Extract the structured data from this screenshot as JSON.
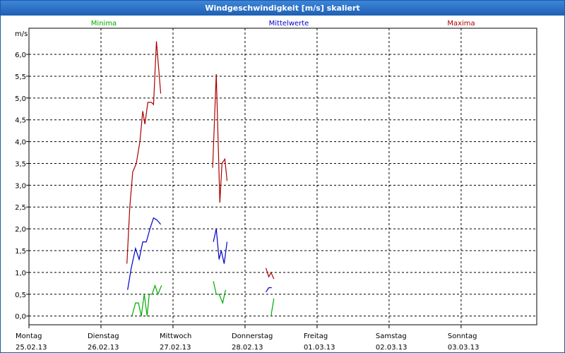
{
  "window": {
    "title": "Windgeschwindigkeit [m/s] skaliert"
  },
  "chart_data": {
    "type": "line",
    "title": "Windgeschwindigkeit [m/s] skaliert",
    "ylabel": "m/s",
    "xlabel": "",
    "ylim": [
      -0.2,
      6.6
    ],
    "xlim": [
      0,
      7.05
    ],
    "grid": true,
    "legend_position": "top",
    "yticks": [
      "0,0",
      "0,5",
      "1,0",
      "1,5",
      "2,0",
      "2,5",
      "3,0",
      "3,5",
      "4,0",
      "4,5",
      "5,0",
      "5,5",
      "6,0"
    ],
    "ytick_values": [
      0,
      0.5,
      1,
      1.5,
      2,
      2.5,
      3,
      3.5,
      4,
      4.5,
      5,
      5.5,
      6
    ],
    "xticks": [
      {
        "day": "Montag",
        "date": "25.02.13",
        "x": 0
      },
      {
        "day": "Dienstag",
        "date": "26.02.13",
        "x": 1
      },
      {
        "day": "Mittwoch",
        "date": "27.02.13",
        "x": 2
      },
      {
        "day": "Donnerstag",
        "date": "28.02.13",
        "x": 3
      },
      {
        "day": "Freitag",
        "date": "01.03.13",
        "x": 4
      },
      {
        "day": "Samstag",
        "date": "02.03.13",
        "x": 5
      },
      {
        "day": "Sonntag",
        "date": "03.03.13",
        "x": 6
      }
    ],
    "series": [
      {
        "name": "Minima",
        "color": "#00aa00",
        "segments": [
          [
            [
              1.43,
              0.0
            ],
            [
              1.48,
              0.3
            ],
            [
              1.52,
              0.3
            ],
            [
              1.56,
              0.0
            ],
            [
              1.6,
              0.5
            ],
            [
              1.64,
              0.0
            ],
            [
              1.67,
              0.5
            ],
            [
              1.71,
              0.5
            ],
            [
              1.75,
              0.7
            ],
            [
              1.79,
              0.5
            ],
            [
              1.84,
              0.7
            ]
          ],
          [
            [
              2.56,
              0.8
            ],
            [
              2.6,
              0.5
            ],
            [
              2.64,
              0.5
            ],
            [
              2.69,
              0.3
            ],
            [
              2.73,
              0.6
            ]
          ],
          [
            [
              3.36,
              0.0
            ],
            [
              3.4,
              0.4
            ]
          ]
        ]
      },
      {
        "name": "Mittelwerte",
        "color": "#0000cc",
        "segments": [
          [
            [
              1.37,
              0.6
            ],
            [
              1.42,
              1.1
            ],
            [
              1.48,
              1.55
            ],
            [
              1.53,
              1.3
            ],
            [
              1.58,
              1.7
            ],
            [
              1.63,
              1.7
            ],
            [
              1.68,
              2.0
            ],
            [
              1.73,
              2.25
            ],
            [
              1.78,
              2.2
            ],
            [
              1.83,
              2.1
            ]
          ],
          [
            [
              2.56,
              1.7
            ],
            [
              2.6,
              2.0
            ],
            [
              2.64,
              1.3
            ],
            [
              2.67,
              1.5
            ],
            [
              2.71,
              1.2
            ],
            [
              2.75,
              1.7
            ]
          ],
          [
            [
              3.29,
              0.55
            ],
            [
              3.33,
              0.65
            ],
            [
              3.37,
              0.65
            ]
          ]
        ]
      },
      {
        "name": "Maxima",
        "color": "#aa0000",
        "segments": [
          [
            [
              1.36,
              1.2
            ],
            [
              1.4,
              2.5
            ],
            [
              1.44,
              3.3
            ],
            [
              1.49,
              3.5
            ],
            [
              1.54,
              4.0
            ],
            [
              1.58,
              4.7
            ],
            [
              1.61,
              4.4
            ],
            [
              1.65,
              4.9
            ],
            [
              1.7,
              4.9
            ],
            [
              1.73,
              4.85
            ],
            [
              1.77,
              6.3
            ],
            [
              1.83,
              5.1
            ]
          ],
          [
            [
              2.55,
              3.4
            ],
            [
              2.6,
              5.55
            ],
            [
              2.65,
              2.6
            ],
            [
              2.68,
              3.5
            ],
            [
              2.72,
              3.6
            ],
            [
              2.75,
              3.1
            ]
          ],
          [
            [
              3.29,
              1.1
            ],
            [
              3.33,
              0.9
            ],
            [
              3.36,
              1.0
            ],
            [
              3.4,
              0.85
            ]
          ]
        ]
      }
    ]
  }
}
